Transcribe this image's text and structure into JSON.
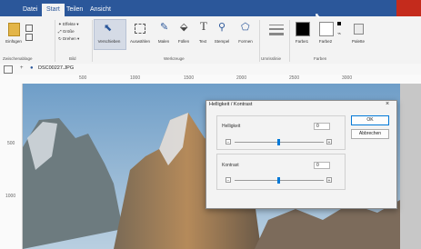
{
  "tabs": [
    "Datei",
    "Start",
    "Teilen",
    "Ansicht"
  ],
  "ribbon": {
    "paste_label": "Einfügen",
    "image_group": {
      "effects": "Effekte",
      "size": "Größe",
      "rotate": "Drehen"
    },
    "tools": [
      "Verschieben",
      "Auswählen",
      "Malen",
      "Füllen",
      "Text",
      "Stempel",
      "Formen"
    ],
    "outline_label": "Umrisslinie",
    "color1_label": "Farbe1",
    "color2_label": "Farbe2",
    "palette_label": "Palette",
    "groups": [
      "Zwischenablage",
      "Bild",
      "Werkzeuge",
      "Farben"
    ]
  },
  "toolbar": {
    "filename": "DSC00227.JPG"
  },
  "ruler": {
    "h": [
      "500",
      "1000",
      "1500",
      "2000",
      "2500",
      "3000"
    ],
    "v": [
      "500",
      "1000"
    ]
  },
  "colors": {
    "titlebar": "#2b579a",
    "close": "#c42b1c",
    "color1": "#000000",
    "color2": "#ffffff",
    "accent": "#0078d7"
  },
  "dialog": {
    "title": "Helligkeit / Kontrast",
    "brightness": {
      "label": "Helligkeit",
      "value": "0"
    },
    "contrast": {
      "label": "Kontrast",
      "value": "0"
    },
    "ok": "OK",
    "cancel": "Abbrechen"
  }
}
